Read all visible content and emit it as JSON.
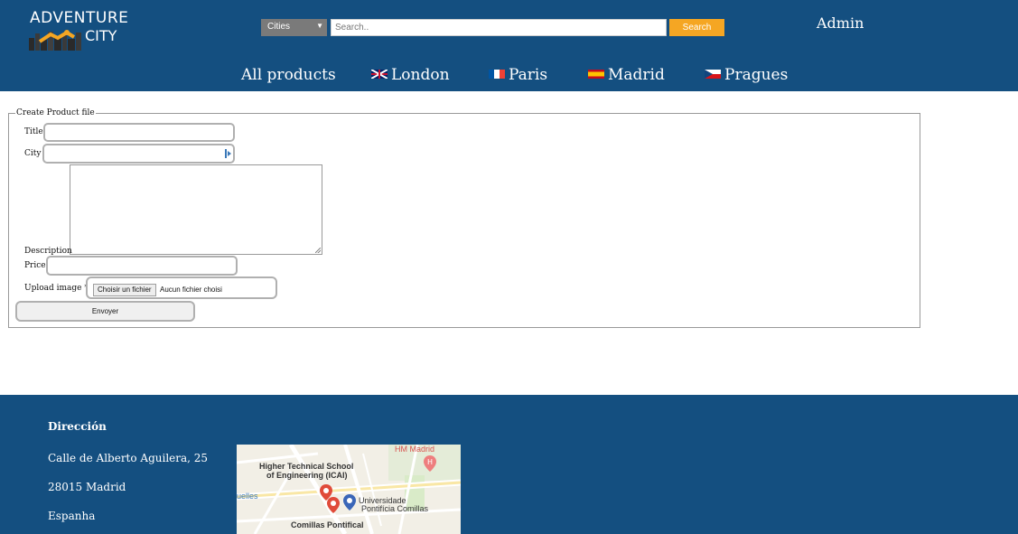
{
  "header": {
    "logo_line1": "ADVENTURE",
    "logo_line2": "CITY",
    "search_select": "Cities",
    "search_placeholder": "Search..",
    "search_button": "Search",
    "user": "Admin",
    "nav": [
      {
        "label": "All products",
        "icon": "none"
      },
      {
        "label": "London",
        "icon": "uk-flag-icon"
      },
      {
        "label": "Paris",
        "icon": "france-flag-icon"
      },
      {
        "label": "Madrid",
        "icon": "spain-flag-icon"
      },
      {
        "label": "Pragues",
        "icon": "czech-flag-icon"
      }
    ],
    "bg_color": "#144f80",
    "accent_color": "#f5a623"
  },
  "form": {
    "legend": "Create Product file",
    "title_label": "Title",
    "title_value": "",
    "city_label": "City",
    "city_value": "",
    "description_label": "Description",
    "description_value": "",
    "price_label": "Price",
    "price_value": "",
    "upload_label": "Upload image *",
    "file_button": "Choisir un fichier",
    "file_status": "Aucun fichier choisi",
    "submit": "Envoyer"
  },
  "footer": {
    "heading": "Dirección",
    "address1": "Calle de Alberto Aguilera, 25",
    "address2": "28015 Madrid",
    "address3": "Espanha",
    "map": {
      "labels": [
        "HM Madrid",
        "Higher Technical School",
        "of Engineering (ICAI)",
        "Universidade",
        "Pontifícia Comillas",
        "Comillas Pontifical",
        "uelles"
      ]
    }
  }
}
